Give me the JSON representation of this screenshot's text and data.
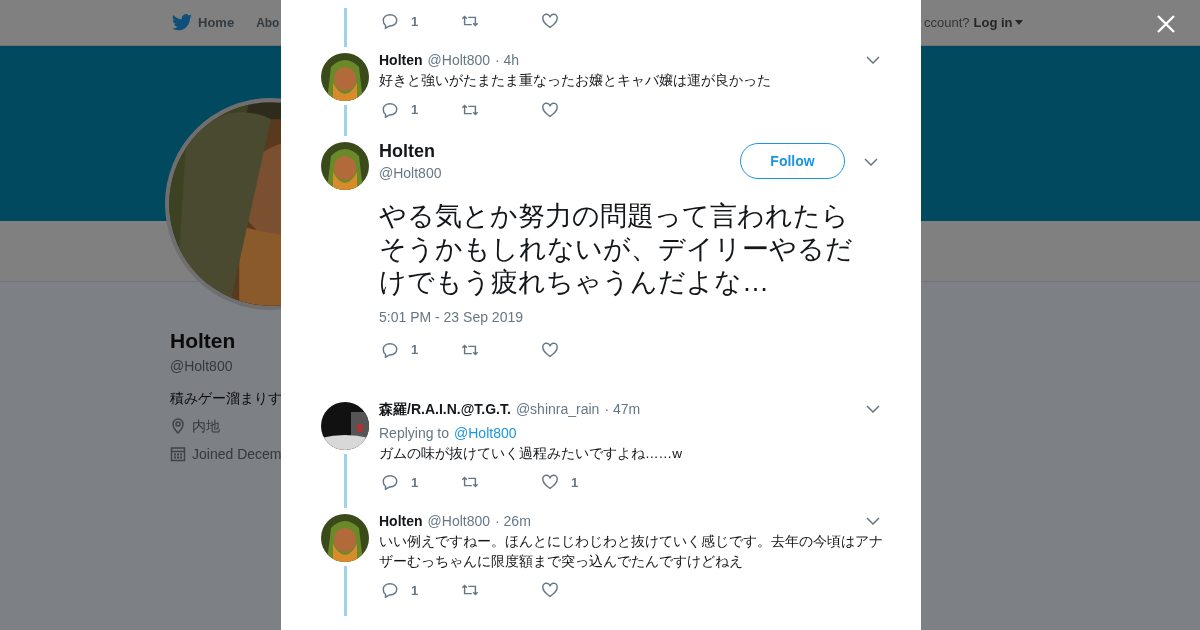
{
  "nav": {
    "home": "Home",
    "about": "Abo",
    "account_prompt": "ccount?",
    "login": "Log in"
  },
  "profile": {
    "name": "Holten",
    "handle": "@Holt800",
    "bio": "積みゲー溜まりす",
    "location": "内地",
    "joined": "Joined Decem"
  },
  "modal": {
    "top_actions": {
      "replies": "1",
      "threaded": true
    },
    "tweets": [
      {
        "kind": "reply",
        "name": "Holten",
        "handle": "@Holt800",
        "time": "· 4h",
        "text": "好きと強いがたまたま重なったお嬢とキャバ嬢は運が良かった",
        "replies": "1",
        "threaded": true
      },
      {
        "kind": "main",
        "name": "Holten",
        "handle": "@Holt800",
        "follow": "Follow",
        "text": "やる気とか努力の問題って言われたらそうかもしれないが、デイリーやるだけでもう疲れちゃうんだよな…",
        "timestamp": "5:01 PM - 23 Sep 2019",
        "replies": "1",
        "threaded": false
      },
      {
        "kind": "reply",
        "name": "森羅/R.A.I.N.@T.G.T.",
        "handle": "@shinra_rain",
        "time": "· 47m",
        "replying_label": "Replying to",
        "replying_handle": "@Holt800",
        "text": "ガムの味が抜けていく過程みたいですよね……w",
        "replies": "1",
        "likes": "1",
        "threaded": true
      },
      {
        "kind": "reply",
        "name": "Holten",
        "handle": "@Holt800",
        "time": "· 26m",
        "text": "いい例えですねー。ほんとにじわじわと抜けていく感じです。去年の今頃はアナザーむっちゃんに限度額まで突っ込んでたんですけどねえ",
        "replies": "1",
        "threaded": true
      }
    ]
  }
}
